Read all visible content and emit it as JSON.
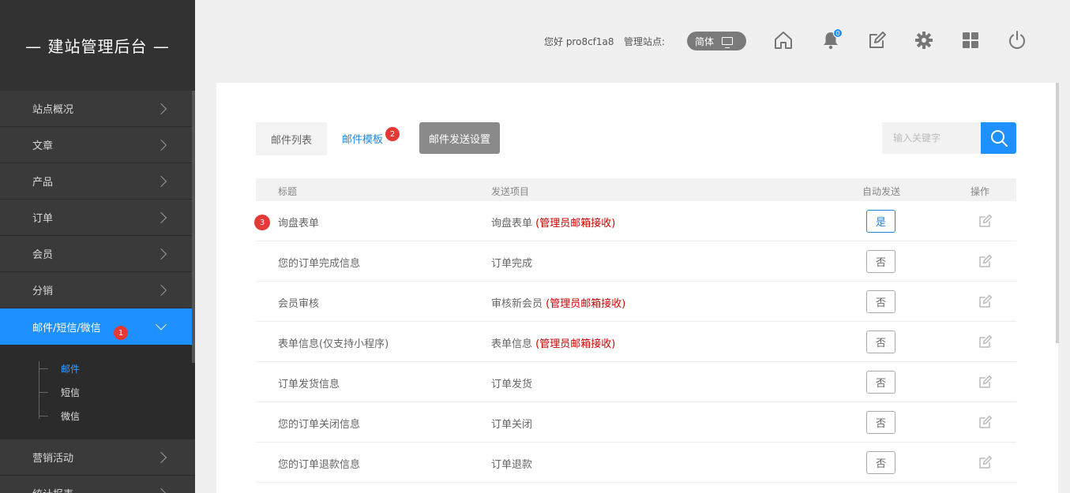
{
  "brand": {
    "title": "— 建站管理后台 —"
  },
  "sidebar": {
    "items": [
      {
        "label": "站点概况"
      },
      {
        "label": "文章"
      },
      {
        "label": "产品"
      },
      {
        "label": "订单"
      },
      {
        "label": "会员"
      },
      {
        "label": "分销"
      },
      {
        "label": "邮件/短信/微信",
        "badge": "1"
      },
      {
        "label": "营销活动"
      },
      {
        "label": "统计报表"
      }
    ],
    "sub_items": [
      {
        "label": "邮件"
      },
      {
        "label": "短信"
      },
      {
        "label": "微信"
      }
    ]
  },
  "header": {
    "greeting": "您好 pro8cf1a8",
    "site_label": "管理站点:",
    "lang": "简体",
    "notif_count": "0",
    "icons": [
      "home-icon",
      "bell-icon",
      "edit-icon",
      "gear-icon",
      "grid-icon",
      "power-icon"
    ]
  },
  "tabs": {
    "list_label": "邮件列表",
    "template_label": "邮件模板",
    "template_badge": "2",
    "send_settings_label": "邮件发送设置"
  },
  "search": {
    "placeholder": "输入关键字"
  },
  "table": {
    "headers": {
      "title": "标题",
      "item": "发送项目",
      "auto": "自动发送",
      "op": "操作"
    },
    "row_badge": "3",
    "rows": [
      {
        "title": "询盘表单",
        "item": "询盘表单",
        "note": "(管理员邮箱接收)",
        "auto": "是"
      },
      {
        "title": "您的订单完成信息",
        "item": "订单完成",
        "note": "",
        "auto": "否"
      },
      {
        "title": "会员审核",
        "item": "审核新会员",
        "note": "(管理员邮箱接收)",
        "auto": "否"
      },
      {
        "title": "表单信息(仅支持小程序)",
        "item": "表单信息",
        "note": "(管理员邮箱接收)",
        "auto": "否"
      },
      {
        "title": "订单发货信息",
        "item": "订单发货",
        "note": "",
        "auto": "否"
      },
      {
        "title": "您的订单关闭信息",
        "item": "订单关闭",
        "note": "",
        "auto": "否"
      },
      {
        "title": "您的订单退款信息",
        "item": "订单退款",
        "note": "",
        "auto": "否"
      }
    ]
  },
  "colors": {
    "accent": "#1e90ff",
    "sidebar_bg": "#323232",
    "badge_red": "#e53935",
    "note_red": "#cc0000"
  }
}
